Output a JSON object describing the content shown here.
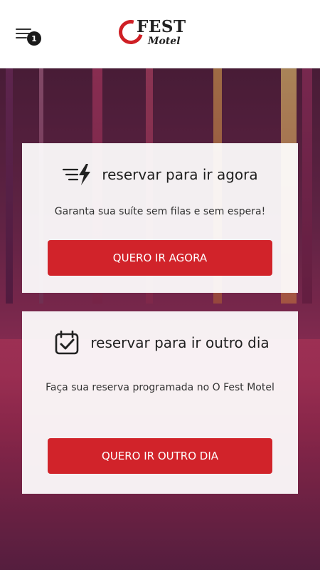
{
  "header": {
    "menu_icon": "menu-icon",
    "badge_count": "1",
    "logo": {
      "fest": "FEST",
      "motel": "Motel"
    }
  },
  "cards": [
    {
      "icon": "lightning-speed-icon",
      "title": "reservar para ir agora",
      "description": "Garanta sua suíte sem filas e sem espera!",
      "button_label": "QUERO IR AGORA"
    },
    {
      "icon": "calendar-check-icon",
      "title": "reservar para ir outro dia",
      "description": "Faça sua reserva programada no O Fest Motel",
      "button_label": "QUERO IR OUTRO DIA"
    }
  ],
  "colors": {
    "accent": "#d1232a",
    "logo_red": "#cf1f25"
  }
}
